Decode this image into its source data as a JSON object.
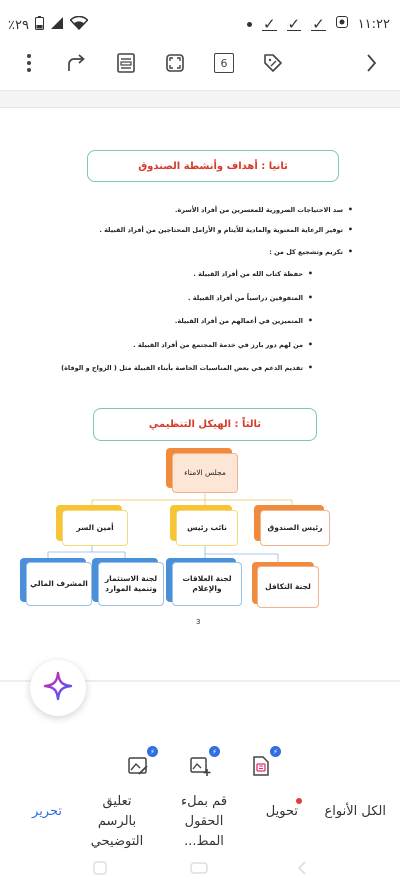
{
  "status_bar": {
    "time": "١١:٢٢",
    "battery": "٪٢٩"
  },
  "toolbar": {
    "page_count": "6"
  },
  "document": {
    "section2_title": "ثانيا : أهداف وأنشطة الصندوق",
    "bullets": [
      "سد الاحتياجات الضرورية للمعسرين من أفراد الأسرة.",
      "توفير الرعاية المعنوية والمادية للأيتام و الأرامل المحتاجين من أفراد القبيلة .",
      "تكريم وتشجيع كل من :",
      "حفظة كتاب الله من أفراد القبيلة .",
      "المتفوقين دراسياً من أفراد القبيلة .",
      "المتميزين في أعمالهم من أفراد القبيلة.",
      "من لهم دور بارز في خدمة المجتمع من أفراد القبيلة .",
      "تقديم الدعم في بعض المناسبات الخاصة بأبناء القبيلة مثل ( الزواج و الوفاة)"
    ],
    "section3_title": "ثالثاً : الهيكل التنظيمي",
    "org": {
      "top": "مجلس الامناء",
      "level2": [
        "رئيس الصندوق",
        "نائب رئيس",
        "أمين السر"
      ],
      "level3": [
        "لجنة التكافل",
        "لجنة العلاقات والإعلام",
        "لجنة الاستثمار وتنمية الموارد",
        "المشرف المالي"
      ]
    },
    "page_number": "3"
  },
  "bottom_tabs": [
    "الكل الأنواع",
    "تحويل",
    "قم بملء الحقول المط...",
    "تعليق بالرسم التوضيحي",
    "تحرير"
  ],
  "colors": {
    "accent": "#2f6fe4",
    "title_red": "#d83a2a",
    "title_border": "#7fc7a9",
    "orange": "#f08a3c",
    "yellow": "#f7c435",
    "blue": "#4a90d9"
  }
}
